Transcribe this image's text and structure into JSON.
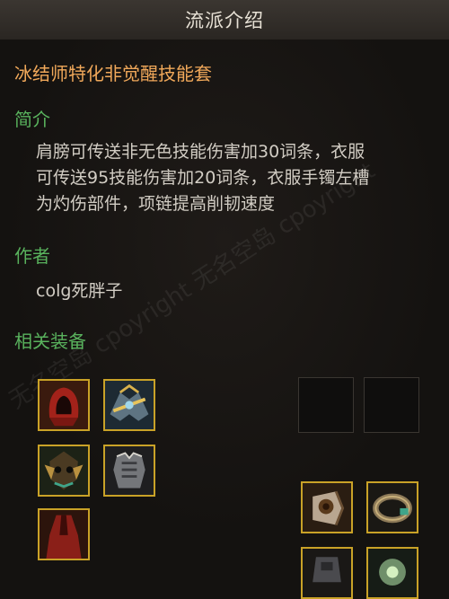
{
  "window": {
    "title": "流派介绍"
  },
  "build": {
    "name": "冰结师特化非觉醒技能套"
  },
  "sections": {
    "intro": {
      "label": "简介",
      "lines": [
        "肩膀可传送非无色技能伤害加30词条，衣服",
        "可传送95技能伤害加20词条，衣服手镯左槽",
        "为灼伤部件，项链提高削韧速度"
      ]
    },
    "author": {
      "label": "作者",
      "value": "colg死胖子"
    },
    "equipment": {
      "label": "相关装备",
      "slots": [
        {
          "icon": "red-hood-icon",
          "filled": true
        },
        {
          "icon": "shoulder-armor-icon",
          "filled": true
        },
        {
          "icon": "empty-slot",
          "filled": false
        },
        {
          "icon": "empty-slot",
          "filled": false
        },
        {
          "icon": "skull-mask-icon",
          "filled": true
        },
        {
          "icon": "chest-armor-icon",
          "filled": true
        },
        {
          "icon": "arm-bracer-icon",
          "filled": true
        },
        {
          "icon": "bracelet-icon",
          "filled": true
        },
        {
          "icon": "red-robe-icon",
          "filled": true
        },
        {
          "icon": "gauntlet-icon",
          "filled": true
        },
        {
          "icon": "green-orb-icon",
          "filled": true
        }
      ]
    }
  },
  "watermark": {
    "text": "无名空岛 cpoyright 无名空岛 cpoyright"
  },
  "colors": {
    "accent": "#f0a85a",
    "section": "#59b25d",
    "frame": "#c9a227"
  }
}
